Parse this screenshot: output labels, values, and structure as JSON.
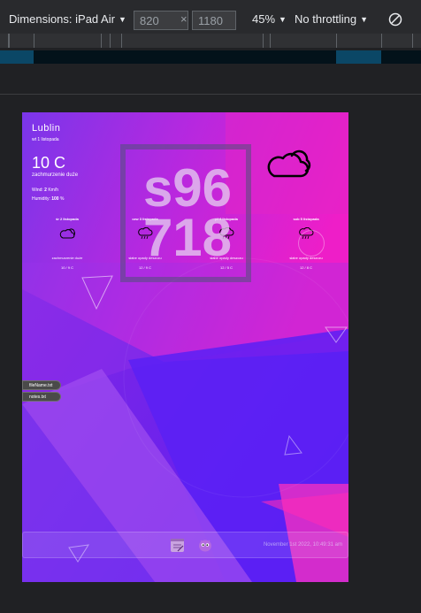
{
  "devtools": {
    "device_label": "Dimensions: iPad Air",
    "width_value": "820",
    "times": "×",
    "height_value": "1180",
    "zoom": "45%",
    "throttling": "No throttling",
    "rotate_icon": "rotate-icon"
  },
  "weather": {
    "city": "Lublin",
    "date": "wt 1 listopada",
    "temperature": "10 C",
    "description": "zachmurzenie duże",
    "wind_label": "Wind:",
    "wind_value": "2",
    "wind_unit": "Km/h",
    "humidity_label": "Humidity:",
    "humidity_value": "100",
    "humidity_unit": "%",
    "main_icon": "cloud-icon",
    "forecast": [
      {
        "day": "śr 2 listopada",
        "icon": "cloud-icon",
        "desc": "zachmurzenie duże",
        "temps": "10 / 9 C"
      },
      {
        "day": "czw 3 listopada",
        "icon": "rain-cloud-icon",
        "desc": "słabe opady deszczu",
        "temps": "12 / 9 C"
      },
      {
        "day": "pt 4 listopada",
        "icon": "rain-cloud-icon",
        "desc": "słabe opady deszczu",
        "temps": "12 / 5 C"
      },
      {
        "day": "sob 5 listopada",
        "icon": "rain-cloud-icon",
        "desc": "słabe opady deszczu",
        "temps": "12 / 8 C"
      }
    ]
  },
  "watermark": {
    "line1": "s96",
    "line2": "718"
  },
  "desktop": {
    "files": [
      "fileName.txt",
      "notes.txt"
    ]
  },
  "taskbar": {
    "apps": [
      "notepad-icon",
      "mascot-icon"
    ],
    "clock": "November 1st 2022, 10:49:31 am"
  },
  "colors": {
    "accent_pink": "#e81ccb",
    "accent_violet": "#6a1cf0",
    "devtools_bg": "#292a2d"
  }
}
